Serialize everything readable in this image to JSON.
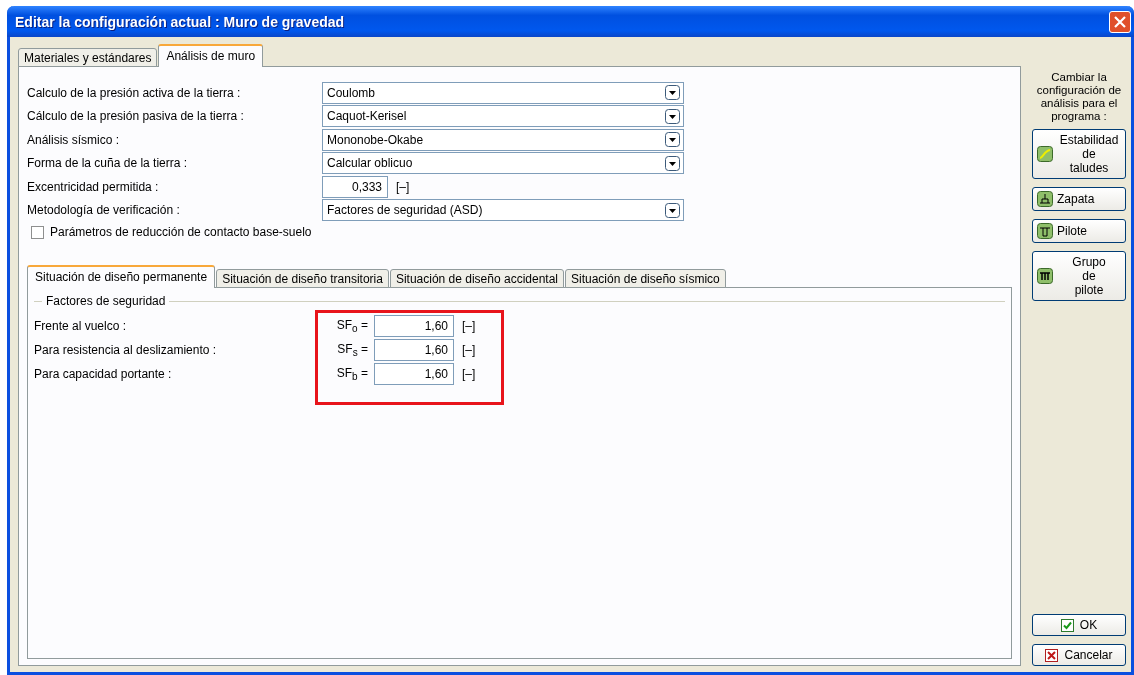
{
  "window": {
    "title": "Editar la configuración actual : Muro de gravedad"
  },
  "tabs": [
    {
      "label": "Materiales y estándares",
      "selected": false
    },
    {
      "label": "Análisis de muro",
      "selected": true
    }
  ],
  "settings": [
    {
      "kind": "dropdown",
      "label": "Calculo de la presión activa de la tierra :",
      "value": "Coulomb"
    },
    {
      "kind": "dropdown",
      "label": "Cálculo de la presión pasiva de la tierra  :",
      "value": "Caquot-Kerisel"
    },
    {
      "kind": "dropdown",
      "label": "Análisis sísmico :",
      "value": "Mononobe-Okabe"
    },
    {
      "kind": "dropdown",
      "label": "Forma de la cuña de la tierra :",
      "value": "Calcular oblicuo"
    },
    {
      "kind": "number",
      "label": "Excentricidad permitida :",
      "value": "0,333",
      "unit": "[–]"
    },
    {
      "kind": "dropdown",
      "label": "Metodología de verificación :",
      "value": "Factores de seguridad (ASD)"
    }
  ],
  "checkbox": {
    "label": "Parámetros de reducción de contacto base-suelo",
    "checked": false
  },
  "design_tabs": [
    {
      "label": "Situación de diseño permanente",
      "selected": true
    },
    {
      "label": "Situación de diseño transitoria",
      "selected": false
    },
    {
      "label": "Situación de diseño accidental",
      "selected": false
    },
    {
      "label": "Situación de diseño sísmico",
      "selected": false
    }
  ],
  "factors": {
    "title": "Factores de seguridad",
    "highlighted": true,
    "rows": [
      {
        "label": "Frente al vuelco :",
        "symbol": "SF$_{o}$ =",
        "value": "1,60",
        "unit": "[–]"
      },
      {
        "label": "Para resistencia al deslizamiento :",
        "symbol": "SF$_{s}$ =",
        "value": "1,60",
        "unit": "[–]"
      },
      {
        "label": "Para capacidad portante :",
        "symbol": "SF$_{b}$ =",
        "value": "1,60",
        "unit": "[–]"
      }
    ]
  },
  "side": {
    "caption": "Cambiar la configuración de análisis para el programa :",
    "buttons": [
      {
        "label": "Estabilidad\nde\ntaludes"
      },
      {
        "label": "Zapata"
      },
      {
        "label": "Pilote"
      },
      {
        "label": "Grupo\nde\npilote"
      }
    ]
  },
  "footer": [
    {
      "kind": "ok",
      "label": "OK"
    },
    {
      "kind": "cancel",
      "label": "Cancelar"
    }
  ]
}
